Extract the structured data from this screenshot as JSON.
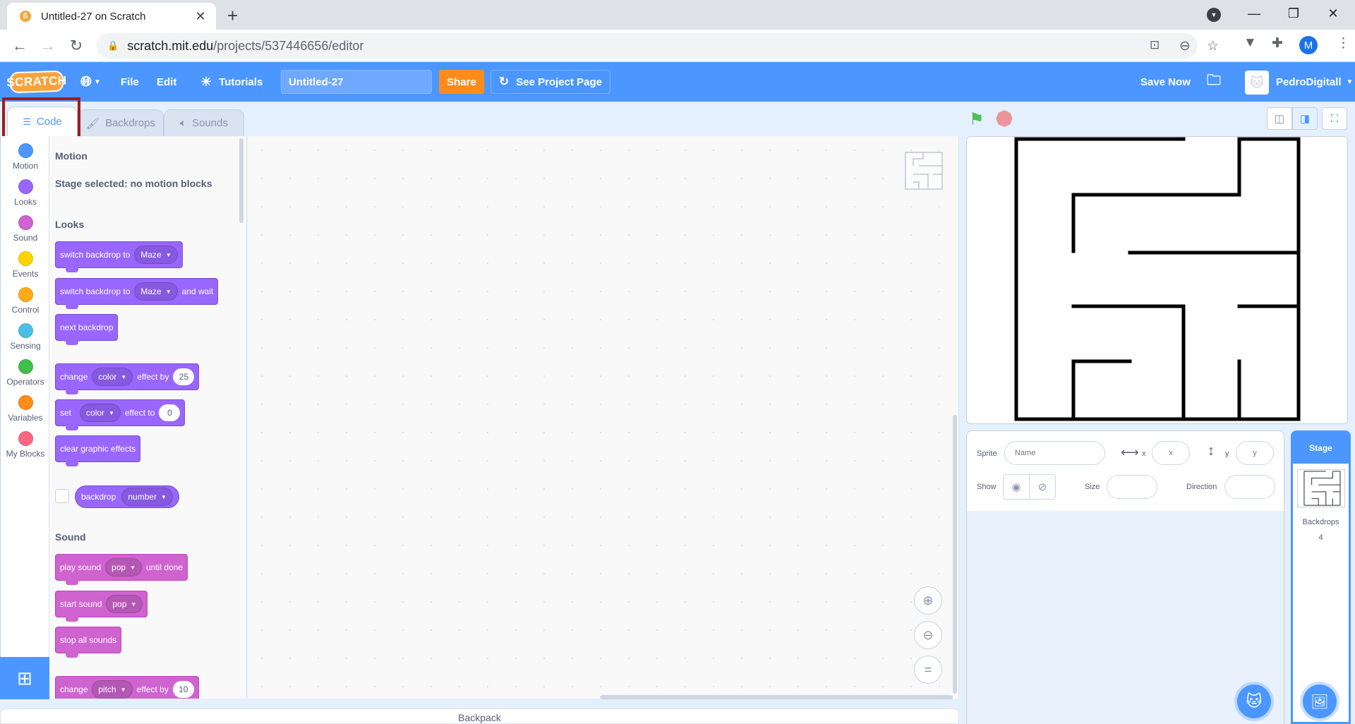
{
  "browser": {
    "tab_title": "Untitled-27 on Scratch",
    "url_host": "scratch.mit.edu",
    "url_path": "/projects/537446656/editor",
    "profile_initial": "M"
  },
  "menubar": {
    "logo": "SCRATCH",
    "file": "File",
    "edit": "Edit",
    "tutorials": "Tutorials",
    "project_title": "Untitled-27",
    "share": "Share",
    "see_project_page": "See Project Page",
    "save_now": "Save Now",
    "username": "PedroDigitall"
  },
  "editor_tabs": {
    "code": "Code",
    "backdrops": "Backdrops",
    "sounds": "Sounds"
  },
  "categories": [
    {
      "label": "Motion",
      "color": "#4c97ff"
    },
    {
      "label": "Looks",
      "color": "#9966ff"
    },
    {
      "label": "Sound",
      "color": "#cf63cf"
    },
    {
      "label": "Events",
      "color": "#ffd500"
    },
    {
      "label": "Control",
      "color": "#ffab19"
    },
    {
      "label": "Sensing",
      "color": "#4cbfe6"
    },
    {
      "label": "Operators",
      "color": "#40bf4a"
    },
    {
      "label": "Variables",
      "color": "#ff8c1a"
    },
    {
      "label": "My Blocks",
      "color": "#ff6680"
    }
  ],
  "palette": {
    "motion_heading": "Motion",
    "motion_note": "Stage selected: no motion blocks",
    "looks_heading": "Looks",
    "sound_heading": "Sound",
    "blocks": {
      "switch_backdrop": "switch backdrop to",
      "switch_backdrop_value": "Maze",
      "switch_backdrop_wait": "switch backdrop to",
      "switch_backdrop_wait_value": "Maze",
      "and_wait": "and wait",
      "next_backdrop": "next backdrop",
      "change": "change",
      "change_effect": "color",
      "effect_by": "effect by",
      "change_effect_value": "25",
      "set": "set",
      "set_effect": "color",
      "effect_to": "effect to",
      "set_effect_value": "0",
      "clear_effects": "clear graphic effects",
      "backdrop": "backdrop",
      "backdrop_dd": "number",
      "play_sound": "play sound",
      "play_sound_value": "pop",
      "until_done": "until done",
      "start_sound": "start sound",
      "start_sound_value": "pop",
      "stop_all_sounds": "stop all sounds",
      "change_pitch": "change",
      "pitch_dd": "pitch",
      "pitch_effect_by": "effect by",
      "pitch_value": "10"
    }
  },
  "backpack": "Backpack",
  "sprite_info": {
    "sprite_label": "Sprite",
    "name_placeholder": "Name",
    "x_label": "x",
    "x_placeholder": "x",
    "y_label": "y",
    "y_placeholder": "y",
    "show_label": "Show",
    "size_label": "Size",
    "direction_label": "Direction"
  },
  "stage_panel": {
    "title": "Stage",
    "backdrops_label": "Backdrops",
    "backdrops_count": "4"
  }
}
